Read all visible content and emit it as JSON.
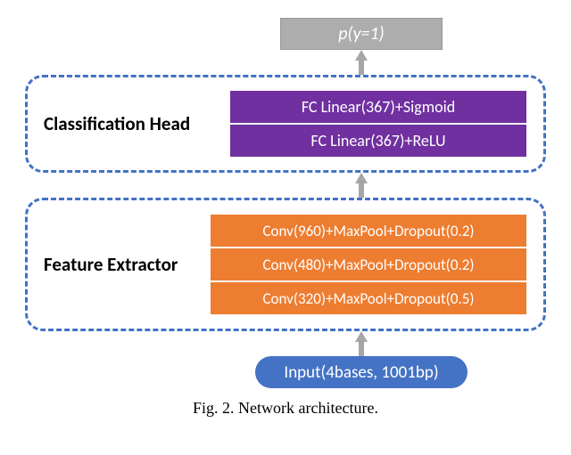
{
  "output": {
    "label": "p(y=1)"
  },
  "classification": {
    "title": "Classification Head",
    "layers": [
      "FC Linear(367)+Sigmoid",
      "FC Linear(367)+ReLU"
    ]
  },
  "feature": {
    "title": "Feature Extractor",
    "layers": [
      "Conv(960)+MaxPool+Dropout(0.2)",
      "Conv(480)+MaxPool+Dropout(0.2)",
      "Conv(320)+MaxPool+Dropout(0.5)"
    ]
  },
  "input": {
    "label": "Input(4bases, 1001bp)"
  },
  "caption": "Fig. 2.  Network architecture."
}
